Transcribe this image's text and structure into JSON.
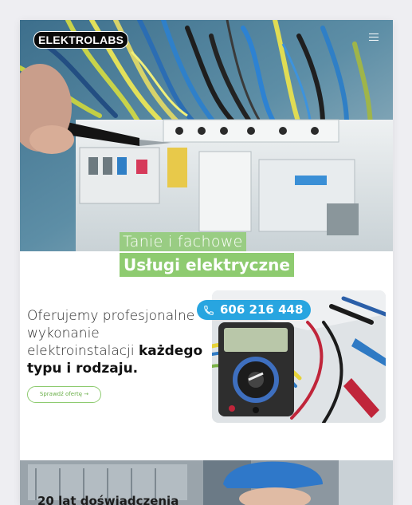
{
  "header": {
    "logo_text": "ELEKTROLABS",
    "menu_icon": "hamburger-icon"
  },
  "hero": {
    "tagline_light": "Tanie i fachowe",
    "tagline_bold": "Usługi elektryczne"
  },
  "intro": {
    "text_regular": "Oferujemy profesjonalne wykonanie elektroinstalacji ",
    "text_bold": "każdego typu i rodzaju.",
    "cta_label": "Sprawdź ofertę  →"
  },
  "contact": {
    "phone": "606 216 448",
    "phone_icon": "phone-icon"
  },
  "experience": {
    "heading": "20 lat doświadczenia"
  },
  "colors": {
    "accent_green": "#8ecb70",
    "phone_blue": "#28a5e0",
    "logo_bg": "#0a0a0a"
  }
}
